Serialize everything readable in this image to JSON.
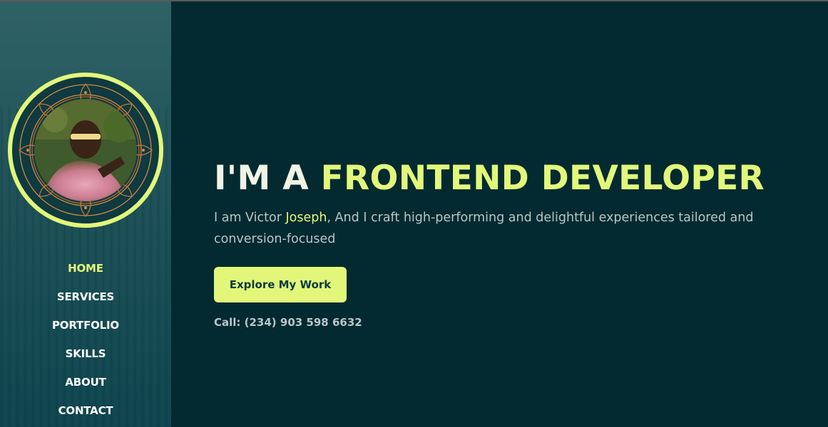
{
  "colors": {
    "accent": "#e2f77a",
    "background": "#022a30",
    "sidebar": "#1f5258",
    "text_muted": "#b7c6c8"
  },
  "sidebar": {
    "avatar": {
      "icon": "profile-photo"
    },
    "nav": [
      {
        "label": "HOME",
        "active": true
      },
      {
        "label": "SERVICES",
        "active": false
      },
      {
        "label": "PORTFOLIO",
        "active": false
      },
      {
        "label": "SKILLS",
        "active": false
      },
      {
        "label": "ABOUT",
        "active": false
      },
      {
        "label": "CONTACT",
        "active": false
      }
    ]
  },
  "hero": {
    "title_prefix": "I'M A ",
    "title_accent": "FRONTEND DEVELOPER",
    "intro_prefix": "I am Victor ",
    "intro_name": "Joseph",
    "intro_suffix": ", And I craft high-performing and delightful experiences tailored and conversion-focused",
    "cta_label": "Explore My Work",
    "call_text": "Call: (234) 903 598 6632"
  }
}
